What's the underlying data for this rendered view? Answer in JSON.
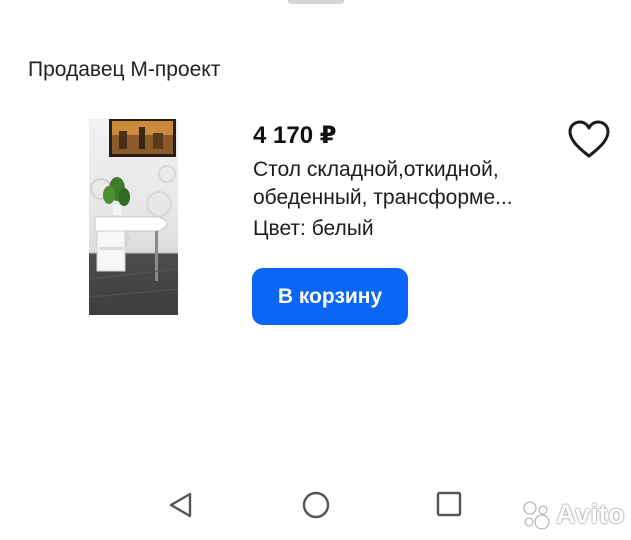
{
  "seller": {
    "label": "Продавец М-проект"
  },
  "product": {
    "price": "4 170 ₽",
    "title_lines": [
      "Стол складной,откидной,",
      "обеденный, трансформе..."
    ],
    "color": "Цвет: белый",
    "image_icon": "product-photo"
  },
  "actions": {
    "cart_button_label": "В корзину",
    "favorite_icon": "heart-icon",
    "accent_color": "#0b66f6"
  },
  "navbar": {
    "back_icon": "triangle-back-icon",
    "home_icon": "circle-home-icon",
    "recent_icon": "square-recent-icon"
  },
  "watermark": {
    "text": "Avito",
    "logo_icon": "avito-logo"
  }
}
